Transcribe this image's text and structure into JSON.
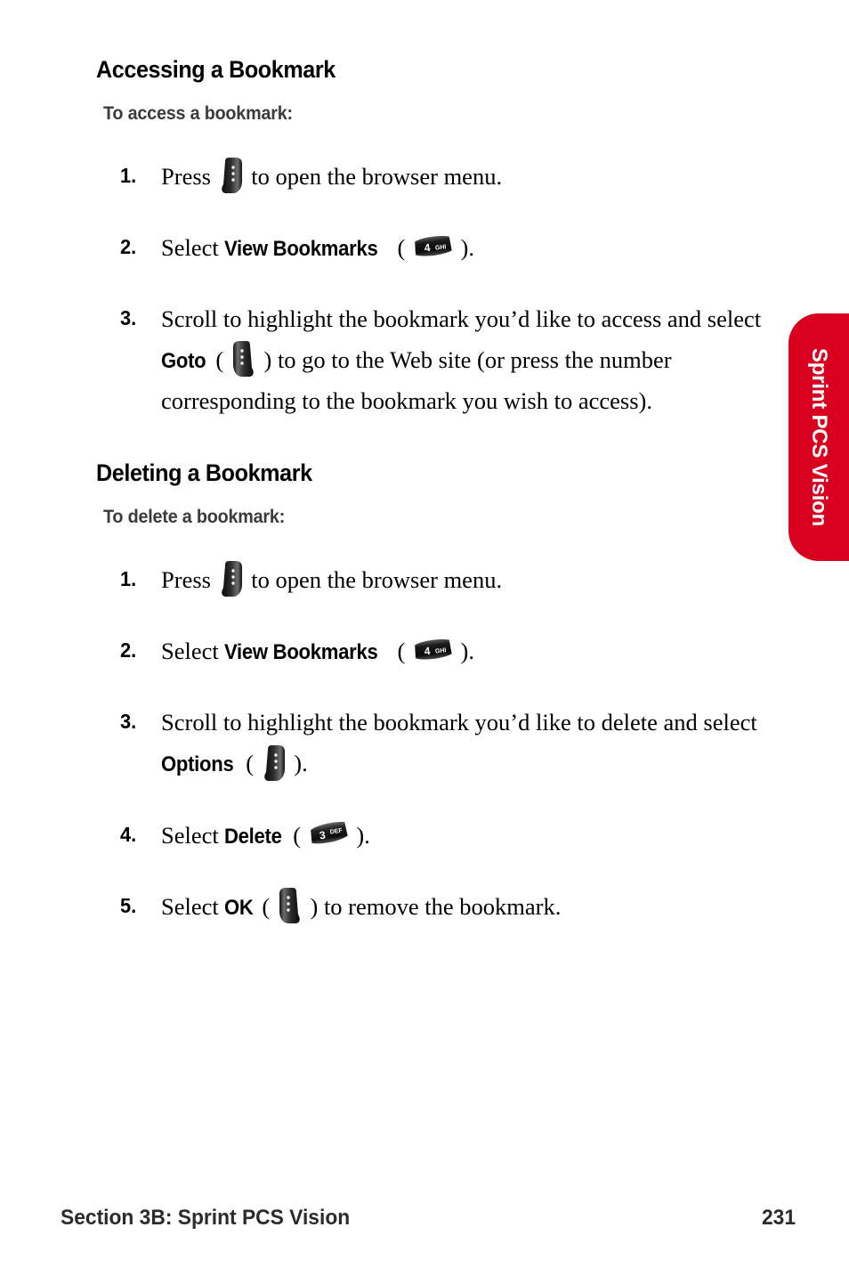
{
  "page": {
    "number": "231",
    "footer_section": "Section 3B: Sprint PCS Vision",
    "side_tab_label": "Sprint PCS Vision",
    "accent_color": "#d9001f"
  },
  "sections": [
    {
      "heading": "Accessing a Bookmark",
      "subheading": "To access a bookmark:",
      "steps": [
        {
          "number": "1.",
          "text_before": "Press",
          "icon": "left-softkey-icon",
          "text_after": "to open the browser menu."
        },
        {
          "number": "2.",
          "text_before": "Select",
          "bold": "View Bookmarks",
          "paren_open": "(",
          "icon": "key-4-ghi-icon",
          "key_digit": "4",
          "key_letters": "GHI",
          "paren_close": ").",
          "text_after": ""
        },
        {
          "number": "3.",
          "text_before": "Scroll to highlight the bookmark you’d like to access and select",
          "bold": "Goto",
          "paren_open": "(",
          "icon": "right-softkey-icon",
          "paren_close": ")",
          "text_after": "to go to the Web site (or press the number corresponding to the bookmark you wish to access)."
        }
      ]
    },
    {
      "heading": "Deleting a Bookmark",
      "subheading": "To delete a bookmark:",
      "steps": [
        {
          "number": "1.",
          "text_before": "Press",
          "icon": "left-softkey-icon",
          "text_after": "to open the browser menu."
        },
        {
          "number": "2.",
          "text_before": "Select",
          "bold": "View Bookmarks",
          "paren_open": "(",
          "icon": "key-4-ghi-icon",
          "key_digit": "4",
          "key_letters": "GHI",
          "paren_close": ").",
          "text_after": ""
        },
        {
          "number": "3.",
          "text_before": "Scroll to highlight the bookmark you’d like to delete and select",
          "bold": "Options",
          "paren_open": "(",
          "icon": "left-softkey-icon",
          "paren_close": ").",
          "text_after": ""
        },
        {
          "number": "4.",
          "text_before": "Select",
          "bold": "Delete",
          "paren_open": "(",
          "icon": "key-3-def-icon",
          "key_digit": "3",
          "key_letters": "DEF",
          "paren_close": ").",
          "text_after": ""
        },
        {
          "number": "5.",
          "text_before": "Select",
          "bold": "OK",
          "paren_open": "(",
          "icon": "right-softkey-icon",
          "paren_close": ")",
          "text_after": "to remove the bookmark."
        }
      ]
    }
  ]
}
